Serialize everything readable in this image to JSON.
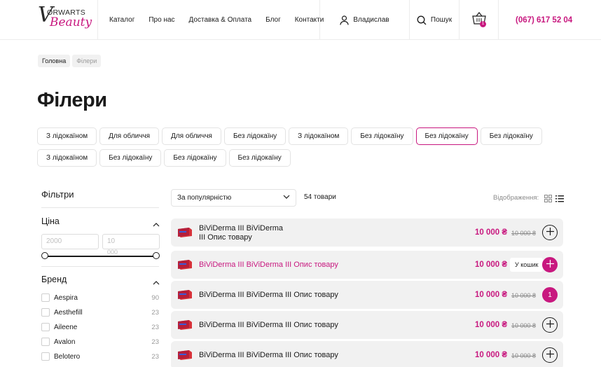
{
  "header": {
    "logo": {
      "letter": "V",
      "top": "ORWARTS",
      "bottom": "Beauty"
    },
    "nav": [
      "Каталог",
      "Про нас",
      "Доставка & Оплата",
      "Блог",
      "Контакти"
    ],
    "user_name": "Владислав",
    "search_label": "Пошук",
    "cart_count": "1",
    "phone": "(067) 617 52 04"
  },
  "breadcrumb": {
    "home": "Головна",
    "current": "Філери"
  },
  "page_title": "Філери",
  "chips": [
    "З лідокаїном",
    "Для обличчя",
    "Для обличчя",
    "Без лідокаїну",
    "З лідокаїном",
    "Без лідокаїну",
    "Без лідокаїну",
    "Без лідокаїну",
    "З лідокаїном",
    "Без лідокаїну",
    "Без лідокаїну",
    "Без лідокаїну"
  ],
  "sidebar": {
    "title": "Фільтри",
    "price": {
      "title": "Ціна",
      "min_placeholder": "2000",
      "max_placeholder": "10",
      "slider_label": "000"
    },
    "brand": {
      "title": "Бренд",
      "items": [
        {
          "name": "Aespira",
          "count": "90"
        },
        {
          "name": "Aesthefill",
          "count": "23"
        },
        {
          "name": "Aileene",
          "count": "23"
        },
        {
          "name": "Avalon",
          "count": "23"
        },
        {
          "name": "Belotero",
          "count": "23"
        }
      ]
    }
  },
  "toolbar": {
    "sort": "За популярністю",
    "count": "54 товари",
    "view_label": "Відображення:"
  },
  "products": [
    {
      "name_line1": "BiViDerma III BiViDerma",
      "name_line2": "III Опис товару",
      "price": "10 000 ₴",
      "old_price": "10 000 ₴"
    },
    {
      "name": "BiViDerma III BiViDerma III Опис товару",
      "price": "10 000 ₴",
      "tooltip": "У кошик"
    },
    {
      "name": "BiViDerma III BiViDerma III Опис товару",
      "price": "10 000 ₴",
      "old_price": "10 000 ₴",
      "qty": "1"
    },
    {
      "name": "BiViDerma III BiViDerma III Опис товару",
      "price": "10 000 ₴",
      "old_price": "10 000 ₴"
    },
    {
      "name": "BiViDerma III BiViDerma III Опис товару",
      "price": "10 000 ₴",
      "old_price": "10 000 ₴"
    }
  ],
  "colors": {
    "accent": "#c8187f",
    "row_bg": "#f1f1f1"
  }
}
